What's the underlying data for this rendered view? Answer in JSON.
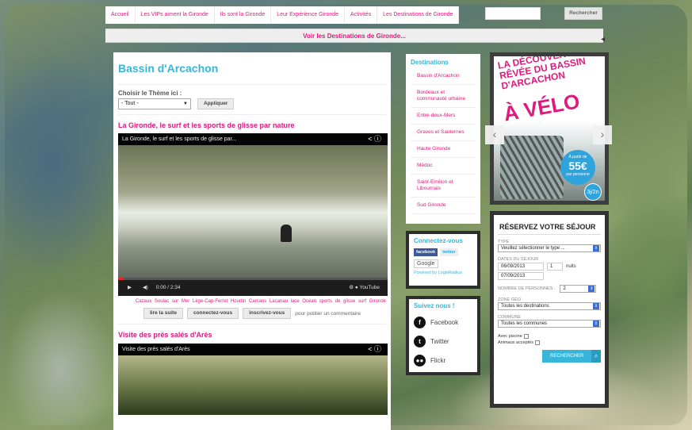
{
  "top_nav": [
    "Accueil",
    "Les VIPs aiment la Gironde",
    "Ils sont la Gironde",
    "Leur Expérience Gironde",
    "Activités",
    "Les Destinations de Gironde"
  ],
  "search": {
    "button": "Rechercher"
  },
  "dest_bar": "Voir les Destinations de Gironde...",
  "page": {
    "title": "Bassin d'Arcachon",
    "theme_label": "Choisir le Thème ici :",
    "theme_value": "- Tout -",
    "apply": "Appliquer"
  },
  "article1": {
    "title": "La Gironde, le surf et les sports de glisse par nature",
    "video_title": "La Gironde, le surf et les sports de glisse par...",
    "time": "0:00 / 2:34",
    "tags": "Cazaux  Soulac sur Mer  Lège-Cap-Ferret  Hourtin  Carcans  Lacanau  lace  Océan  sports de glisse  surf  Gironde",
    "actions": [
      "lire la suite",
      "connectez-vous",
      "inscrivez-vous"
    ],
    "note": "pour publier un commentaire"
  },
  "article2": {
    "title": "Visite des prés salés d'Arès",
    "video_title": "Visite des prés salés d'Arès"
  },
  "destinations": {
    "title": "Destinations",
    "items": [
      "Bassin d'Arcachon",
      "Bordeaux et communauté urbaine",
      "Entre-deux-Mers",
      "Graves et Sauternes",
      "Haute Gironde",
      "Médoc",
      "Saint-Emilion et Libournais",
      "Sud Gironde"
    ]
  },
  "connect": {
    "title": "Connectez-vous",
    "fb": "facebook",
    "tw": "twitter",
    "google": "Google",
    "powered": "Powered by LoginRadius"
  },
  "follow": {
    "title": "Suivez nous !",
    "items": [
      "Facebook",
      "Twitter",
      "Flickr"
    ]
  },
  "promo": {
    "line1": "LA DÉCOUVERTE RÊVÉE DU BASSIN D'ARCACHON",
    "line2": "À VÉLO",
    "price_prefix": "À partir de",
    "price": "55€",
    "price_suffix": "par personne",
    "duration": "3j/2n"
  },
  "reservation": {
    "title": "RÉSERVEZ VOTRE SÉJOUR",
    "type_label": "TYPE",
    "type_value": "Veuillez sélectionner le type ...",
    "dates_label": "DATES DU SÉJOUR",
    "date_from": "06/09/2013",
    "nights": "1",
    "nights_label": "nuits",
    "date_to": "07/09/2013",
    "people_label": "NOMBRE DE PERSONNES :",
    "people_value": "2",
    "zone_label": "ZONE GÉO",
    "zone_value": "Toutes les destinations",
    "commune_label": "COMMUNE",
    "commune_value": "Toutes les communes",
    "pool": "Avec piscine",
    "pets": "Animaux acceptés",
    "submit": "RECHERCHER"
  }
}
